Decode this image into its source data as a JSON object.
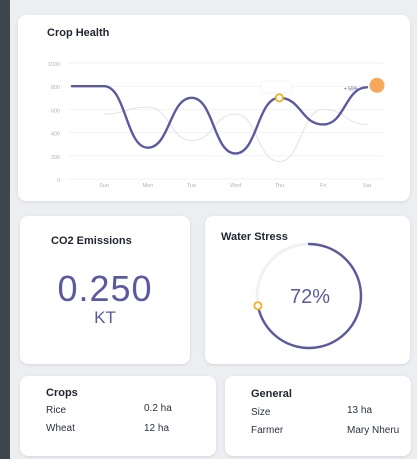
{
  "crop_health": {
    "title": "Crop Health",
    "tooltip_text": "+ 59%",
    "chart_data": {
      "type": "line",
      "title": "Crop Health",
      "categories": [
        "Sun",
        "Mon",
        "Tue",
        "Wed",
        "Thu",
        "Fri",
        "Sat"
      ],
      "ylim": [
        0,
        1000
      ],
      "y_ticks": [
        "0",
        "200",
        "400",
        "600",
        "800",
        "1000"
      ],
      "grid": true,
      "series": [
        {
          "name": "",
          "color": "#5b5a9e",
          "values": [
            800,
            270,
            700,
            220,
            700,
            470,
            790
          ]
        },
        {
          "name": "",
          "color": "#e5e6eb",
          "values": [
            560,
            620,
            330,
            560,
            150,
            600,
            470
          ]
        }
      ],
      "markers": {
        "thu_color": "#f0b020",
        "sat_color": "#f5a85a"
      }
    }
  },
  "co2": {
    "title": "CO2 Emissions",
    "value": "0.250",
    "unit": "KT"
  },
  "water_stress": {
    "title": "Water Stress",
    "value_text": "72%",
    "value": 0.72,
    "arc_color": "#5b5a9e",
    "track_color": "#eeeeF4",
    "marker_color": "#f0b020"
  },
  "crops": {
    "title": "Crops",
    "rows": [
      {
        "label": "Rice",
        "value": "0.2 ha"
      },
      {
        "label": "Wheat",
        "value": "12 ha"
      }
    ]
  },
  "general": {
    "title": "General",
    "rows": [
      {
        "label": "Size",
        "value": "13 ha"
      },
      {
        "label": "Farmer",
        "value": "Mary Nheru"
      }
    ]
  }
}
